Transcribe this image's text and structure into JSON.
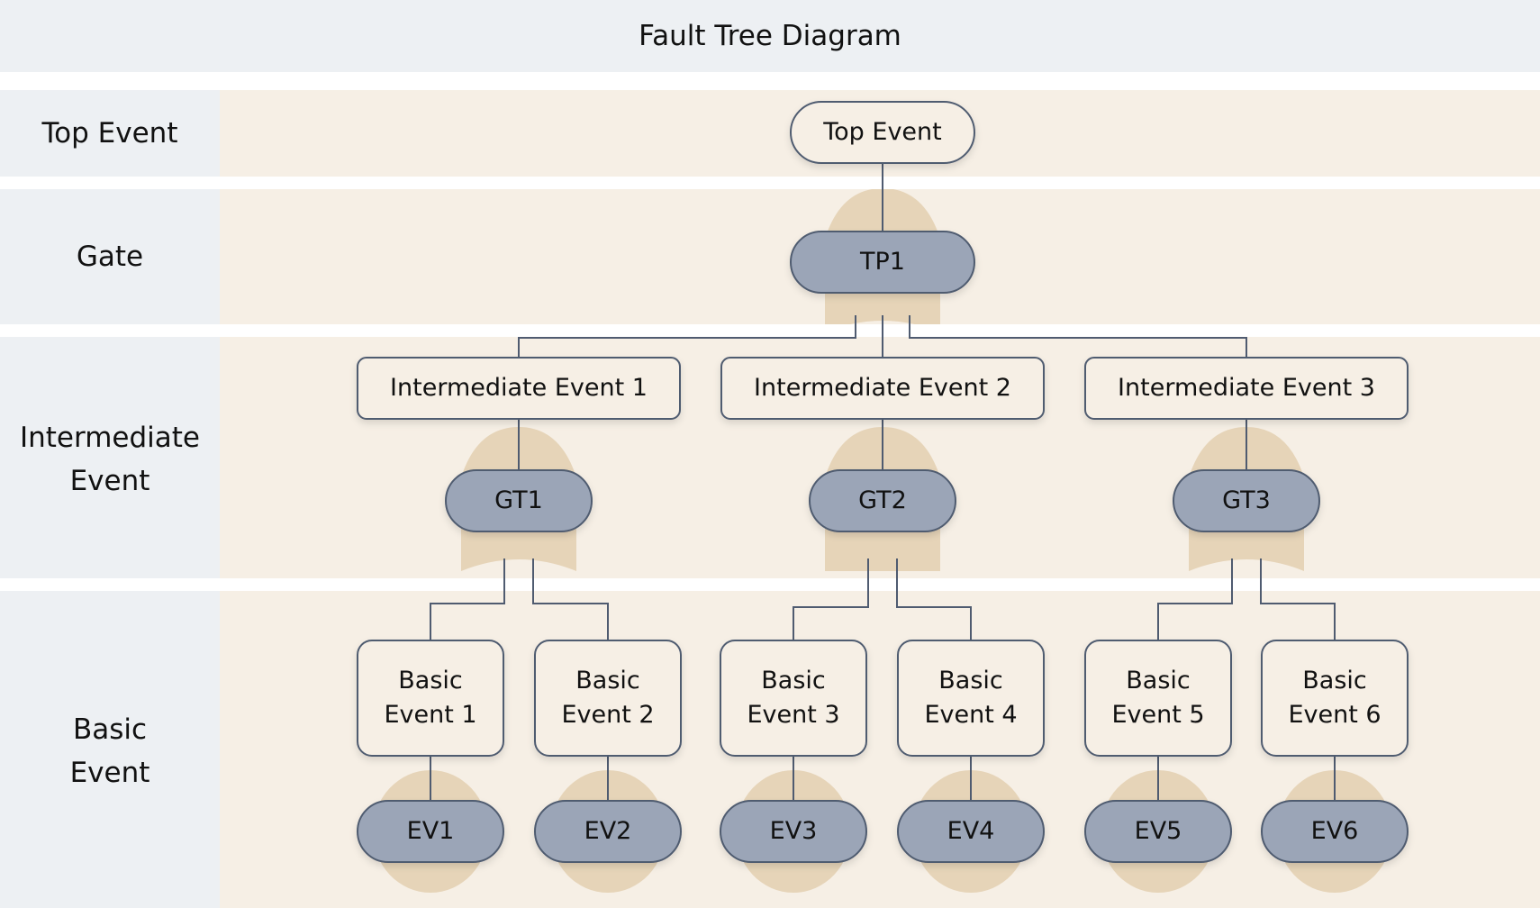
{
  "title": "Fault Tree Diagram",
  "lanes": [
    {
      "id": "top",
      "label": "Top Event"
    },
    {
      "id": "gate",
      "label": "Gate"
    },
    {
      "id": "intermediate",
      "label": "Intermediate\nEvent"
    },
    {
      "id": "basic",
      "label": "Basic\nEvent"
    }
  ],
  "colors": {
    "lane_label_bg": "#edf0f3",
    "lane_body_bg": "#f6efe5",
    "gate_fill": "#9ba5b7",
    "gate_shape_fill": "#e6d4b8",
    "stroke": "#4f5b70",
    "event_box_fill": "#f6efe5"
  },
  "top_event": {
    "id": "top",
    "label": "Top Event",
    "gate": "TP1"
  },
  "gates": [
    {
      "id": "TP1",
      "label": "TP1",
      "type": "or",
      "parent": "top",
      "children": [
        "IE1",
        "IE2",
        "IE3"
      ]
    },
    {
      "id": "GT1",
      "label": "GT1",
      "type": "or",
      "parent": "IE1",
      "children": [
        "BE1",
        "BE2"
      ]
    },
    {
      "id": "GT2",
      "label": "GT2",
      "type": "and",
      "parent": "IE2",
      "children": [
        "BE3",
        "BE4"
      ]
    },
    {
      "id": "GT3",
      "label": "GT3",
      "type": "or",
      "parent": "IE3",
      "children": [
        "BE5",
        "BE6"
      ]
    }
  ],
  "intermediate_events": [
    {
      "id": "IE1",
      "label": "Intermediate Event 1",
      "gate": "GT1"
    },
    {
      "id": "IE2",
      "label": "Intermediate Event 2",
      "gate": "GT2"
    },
    {
      "id": "IE3",
      "label": "Intermediate Event 3",
      "gate": "GT3"
    }
  ],
  "basic_events": [
    {
      "id": "BE1",
      "label": "Basic\nEvent 1",
      "tag": "EV1"
    },
    {
      "id": "BE2",
      "label": "Basic\nEvent 2",
      "tag": "EV2"
    },
    {
      "id": "BE3",
      "label": "Basic\nEvent 3",
      "tag": "EV3"
    },
    {
      "id": "BE4",
      "label": "Basic\nEvent 4",
      "tag": "EV4"
    },
    {
      "id": "BE5",
      "label": "Basic\nEvent 5",
      "tag": "EV5"
    },
    {
      "id": "BE6",
      "label": "Basic\nEvent 6",
      "tag": "EV6"
    }
  ]
}
